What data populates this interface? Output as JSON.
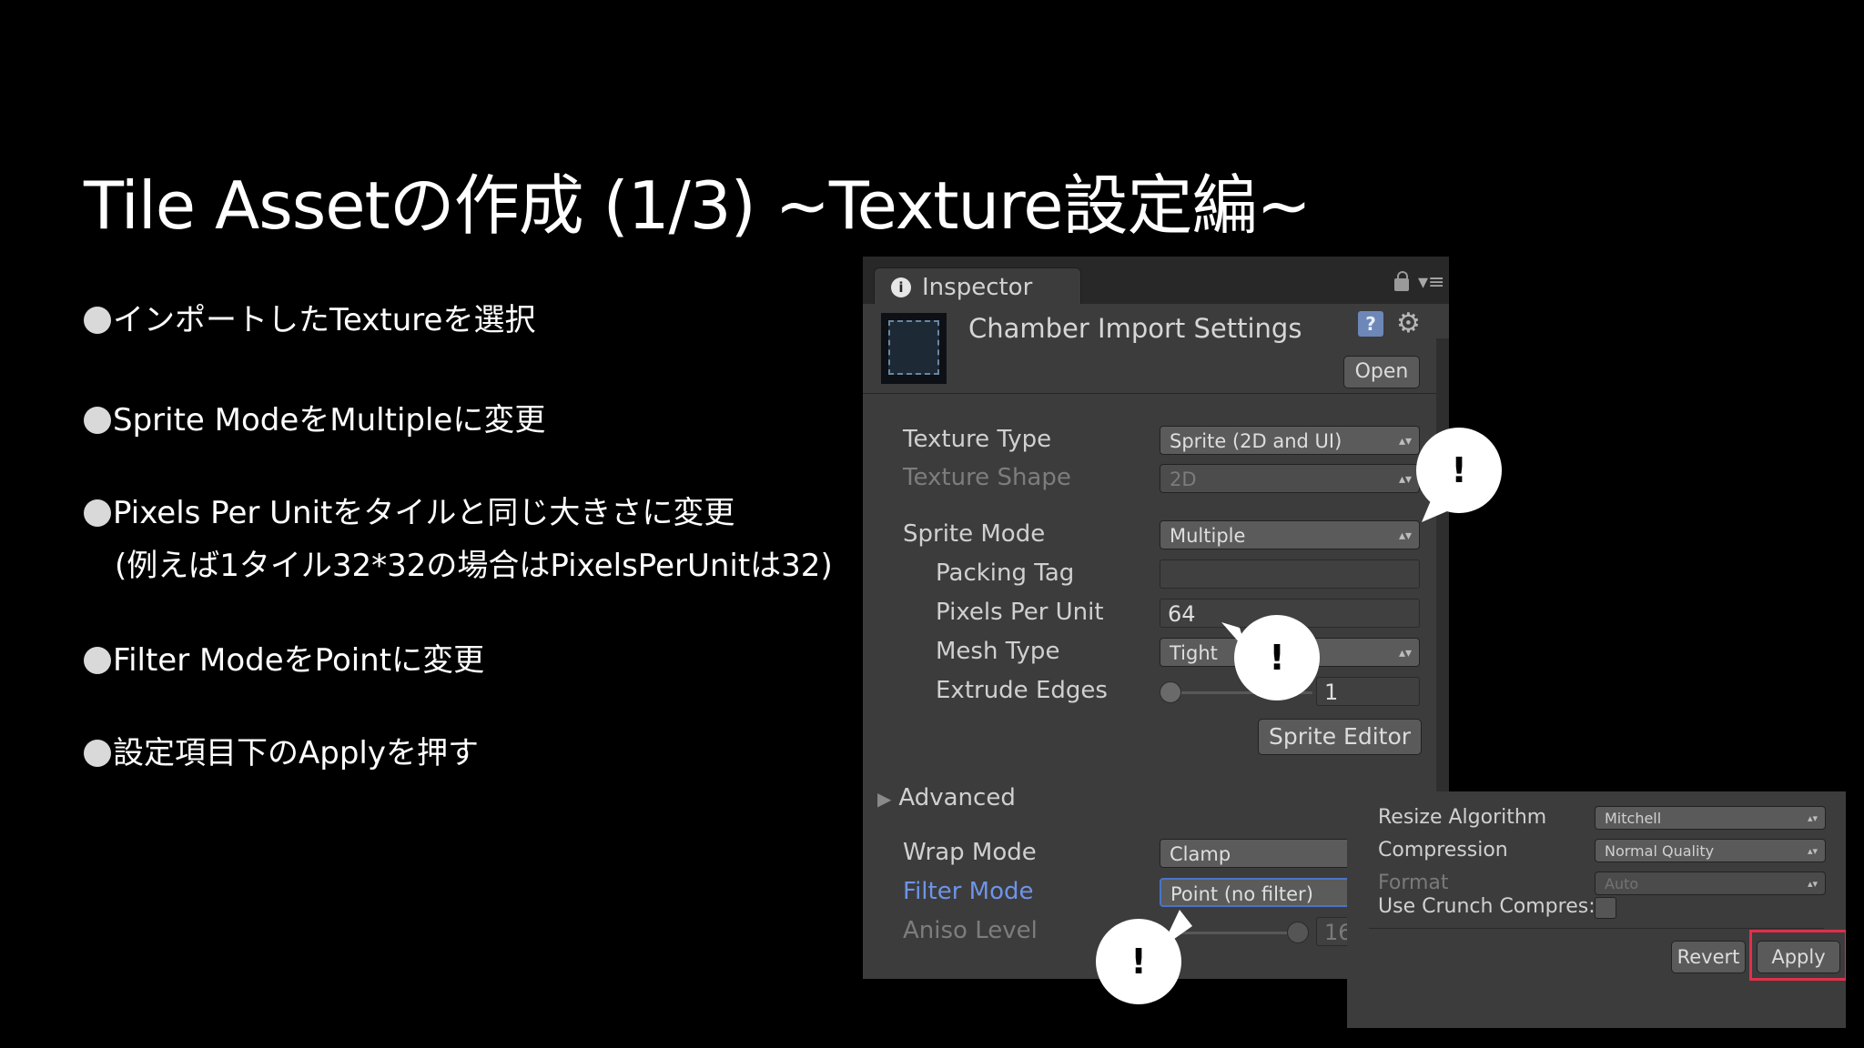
{
  "slide": {
    "title": "Tile Assetの作成 (1/3) ~Texture設定編~",
    "bullets": [
      {
        "text": "インポートしたTextureを選択"
      },
      {
        "text": "Sprite ModeをMultipleに変更"
      },
      {
        "text": "Pixels Per Unitをタイルと同じ大きさに変更",
        "sub": "(例えば1タイル32*32の場合はPixelsPerUnitは32)"
      },
      {
        "text": "Filter ModeをPointに変更"
      },
      {
        "text": "設定項目下のApplyを押す"
      }
    ]
  },
  "inspector": {
    "tab_label": "Inspector",
    "header_title": "Chamber Import Settings",
    "open_label": "Open",
    "rows": {
      "texture_type": {
        "label": "Texture Type",
        "value": "Sprite (2D and UI)"
      },
      "texture_shape": {
        "label": "Texture Shape",
        "value": "2D"
      },
      "sprite_mode": {
        "label": "Sprite Mode",
        "value": "Multiple"
      },
      "packing_tag": {
        "label": "Packing Tag",
        "value": ""
      },
      "pixels_per_unit": {
        "label": "Pixels Per Unit",
        "value": "64"
      },
      "mesh_type": {
        "label": "Mesh Type",
        "value": "Tight"
      },
      "extrude_edges": {
        "label": "Extrude Edges",
        "value": "1"
      },
      "sprite_editor": {
        "label": "Sprite Editor"
      },
      "advanced": {
        "label": "Advanced"
      },
      "wrap_mode": {
        "label": "Wrap Mode",
        "value": "Clamp"
      },
      "filter_mode": {
        "label": "Filter Mode",
        "value": "Point (no filter)"
      },
      "aniso_level": {
        "label": "Aniso Level",
        "value": "16"
      }
    }
  },
  "overlay": {
    "resize_algorithm": {
      "label": "Resize Algorithm",
      "value": "Mitchell"
    },
    "compression": {
      "label": "Compression",
      "value": "Normal Quality"
    },
    "format": {
      "label": "Format",
      "value": "Auto"
    },
    "use_crunch": {
      "label": "Use Crunch Compres:"
    },
    "revert_label": "Revert",
    "apply_label": "Apply"
  },
  "callouts": {
    "mark": "!"
  },
  "colors": {
    "background": "#000000",
    "panel": "#3c3c3c",
    "highlight": "#e0304a",
    "focus_label": "#6e94e8"
  }
}
